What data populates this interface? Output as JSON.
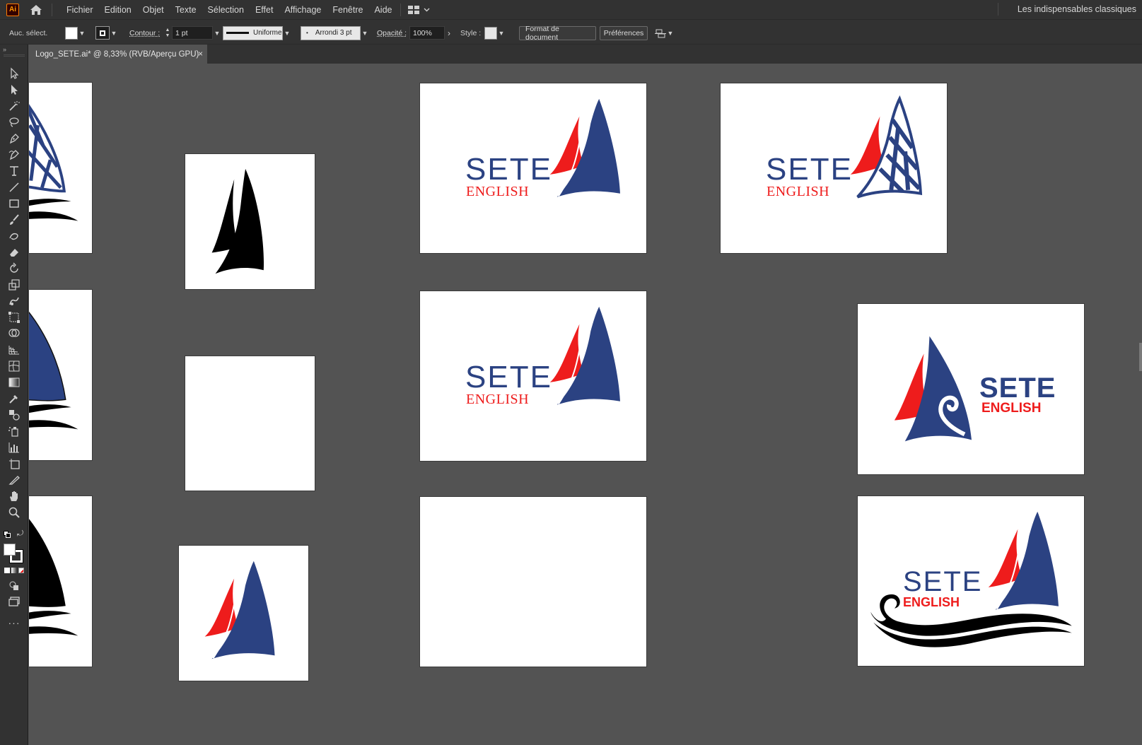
{
  "app": {
    "logo_label": "Ai",
    "workspace_label": "Les indispensables classiques"
  },
  "menu": {
    "items": [
      "Fichier",
      "Edition",
      "Objet",
      "Texte",
      "Sélection",
      "Effet",
      "Affichage",
      "Fenêtre",
      "Aide"
    ]
  },
  "control_bar": {
    "selection_label": "Auc. sélect.",
    "stroke_label": "Contour :",
    "stroke_weight": "1 pt",
    "profile_label": "Uniforme",
    "brush_label": "Arrondi 3 pt",
    "opacity_label": "Opacité :",
    "opacity_value": "100%",
    "style_label": "Style :",
    "document_setup_button": "Format de document",
    "preferences_button": "Préférences"
  },
  "document_tab": {
    "title": "Logo_SETE.ai* @ 8,33% (RVB/Aperçu GPU)",
    "close_glyph": "×"
  },
  "artboards": [
    {
      "name": "sail-lines-partial",
      "logo_text": []
    },
    {
      "name": "black-sails",
      "logo_text": []
    },
    {
      "name": "logo-sete-english-a",
      "logo_text": [
        "SETE",
        "ENGLISH"
      ]
    },
    {
      "name": "logo-sete-english-lined",
      "logo_text": [
        "SETE",
        "ENGLISH"
      ]
    },
    {
      "name": "wave-blue-partial",
      "logo_text": []
    },
    {
      "name": "blank-square",
      "logo_text": []
    },
    {
      "name": "logo-sete-english-b",
      "logo_text": [
        "SETE",
        "ENGLISH"
      ]
    },
    {
      "name": "logo-sete-english-swirl",
      "logo_text": [
        "SETE",
        "ENGLISH"
      ]
    },
    {
      "name": "wave-black-partial",
      "logo_text": []
    },
    {
      "name": "color-sails",
      "logo_text": []
    },
    {
      "name": "blank-wide",
      "logo_text": []
    },
    {
      "name": "logo-sete-english-wave",
      "logo_text": [
        "SETE",
        "ENGLISH"
      ]
    }
  ],
  "colors": {
    "brand_blue": "#2b4282",
    "brand_red": "#ee1c1c",
    "canvas_bg": "#535353",
    "chrome": "#323232"
  }
}
